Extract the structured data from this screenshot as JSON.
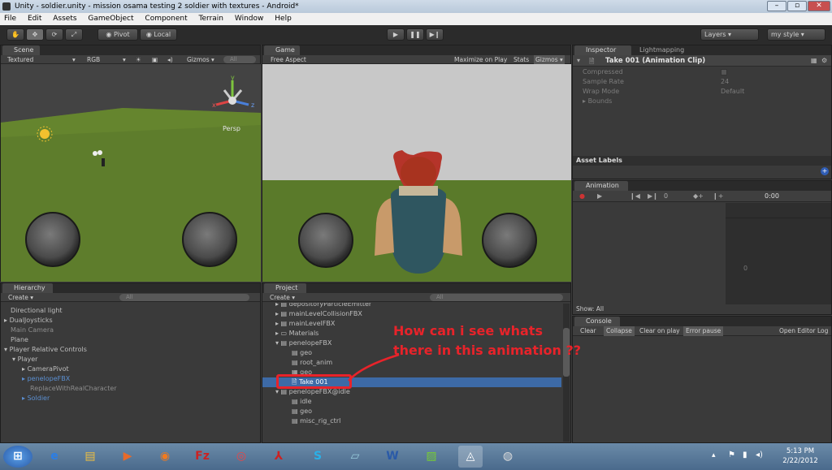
{
  "window": {
    "title": "Unity - soldier.unity - mission osama testing 2 soldier with textures - Android*"
  },
  "menu": [
    "File",
    "Edit",
    "Assets",
    "GameObject",
    "Component",
    "Terrain",
    "Window",
    "Help"
  ],
  "toolbar": {
    "pivot": "Pivot",
    "local": "Local",
    "layers": "Layers",
    "layout": "my style"
  },
  "scene": {
    "tab": "Scene",
    "shading": "Textured",
    "render": "RGB",
    "gizmos": "Gizmos",
    "search": "All",
    "persp": "Persp",
    "axis_x": "x",
    "axis_y": "y",
    "axis_z": "z"
  },
  "game": {
    "tab": "Game",
    "aspect": "Free Aspect",
    "maximize": "Maximize on Play",
    "stats": "Stats",
    "gizmos": "Gizmos"
  },
  "inspector": {
    "tab": "Inspector",
    "tab2": "Lightmapping",
    "header": "Take 001 (Animation Clip)",
    "fields": [
      {
        "label": "Compressed",
        "value": ""
      },
      {
        "label": "Sample Rate",
        "value": "24"
      },
      {
        "label": "Wrap Mode",
        "value": "Default"
      }
    ],
    "bounds": "Bounds",
    "asset_labels": "Asset Labels"
  },
  "animation": {
    "tab": "Animation",
    "frame": "0",
    "time": "0:00",
    "grid_value": "0",
    "show": "Show: All"
  },
  "console": {
    "tab": "Console",
    "clear": "Clear",
    "collapse": "Collapse",
    "clear_on_play": "Clear on play",
    "error_pause": "Error pause",
    "open_log": "Open Editor Log"
  },
  "hierarchy": {
    "tab": "Hierarchy",
    "create": "Create",
    "search": "All",
    "items": [
      "Directional light",
      "DualJoysticks",
      "Main Camera",
      "Plane",
      "Player Relative Controls",
      "Player",
      "CameraPivot",
      "penelopeFBX",
      "ReplaceWithRealCharacter",
      "Soldier"
    ]
  },
  "project": {
    "tab": "Project",
    "create": "Create",
    "search": "All",
    "items": [
      "depositoryParticleEmitter",
      "mainLevelCollisionFBX",
      "mainLevelFBX",
      "Materials",
      "penelopeFBX",
      "geo",
      "root_anim",
      "geo",
      "Take 001",
      "penelopeFBX@idle",
      "idle",
      "geo",
      "misc_rig_ctrl"
    ]
  },
  "annotation": {
    "line1": "How can i see whats",
    "line2": "there in this animation ??",
    "color": "#e8232a"
  },
  "taskbar": {
    "time": "5:13 PM",
    "date": "2/22/2012"
  }
}
